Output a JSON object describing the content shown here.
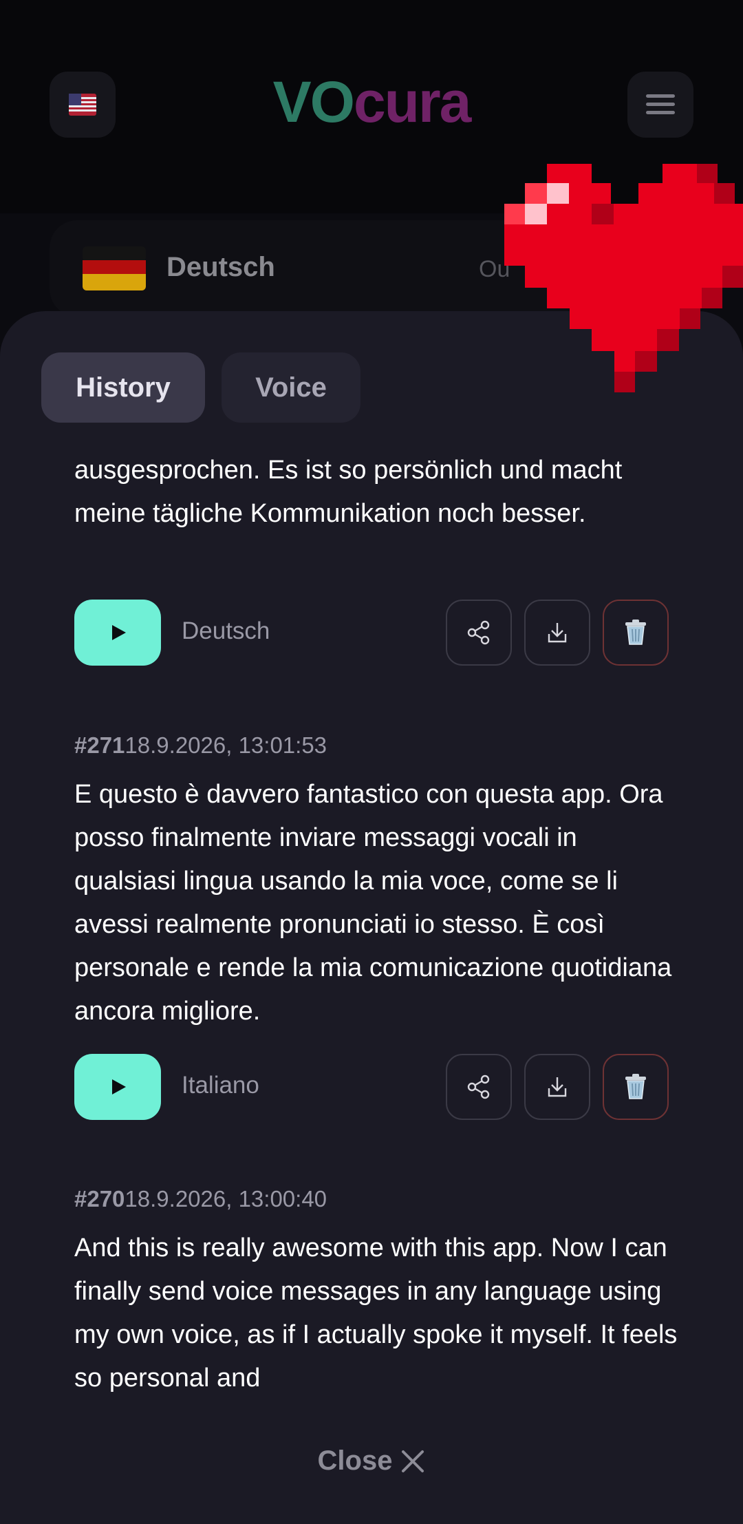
{
  "app": {
    "logo_part1": "VO",
    "logo_part2": "cura"
  },
  "colors": {
    "accent_play": "#70f0d6",
    "logo_green": "#2d7a64",
    "logo_purple": "#6f2266",
    "delete_border": "#6e3234"
  },
  "header": {
    "ui_language_icon": "us-flag-icon",
    "menu_icon": "hamburger-menu-icon"
  },
  "language_selector": {
    "input_language": "Deutsch",
    "output_hint": "Ou"
  },
  "tabs": [
    {
      "label": "History",
      "active": true
    },
    {
      "label": "Voice",
      "active": false
    }
  ],
  "history": [
    {
      "text": "ausgesprochen. Es ist so persönlich und macht meine tägliche Kommunikation noch besser.",
      "language": "Deutsch"
    },
    {
      "id": "#271",
      "timestamp": "18.9.2026, 13:01:53",
      "text": "E questo è davvero fantastico con questa app. Ora posso finalmente inviare messaggi vocali in qualsiasi lingua usando la mia voce, come se li avessi realmente pronunciati io stesso. È così personale e rende la mia comunicazione quotidiana ancora migliore.",
      "language": "Italiano"
    },
    {
      "id": "#270",
      "timestamp": "18.9.2026, 13:00:40",
      "text": "And this is really awesome with this app. Now I can finally send voice messages in any language using my own voice, as if I actually spoke it myself. It feels so personal and"
    }
  ],
  "footer": {
    "close_label": "Close"
  },
  "overlay": {
    "sticker": "pixel-heart-sticker"
  }
}
